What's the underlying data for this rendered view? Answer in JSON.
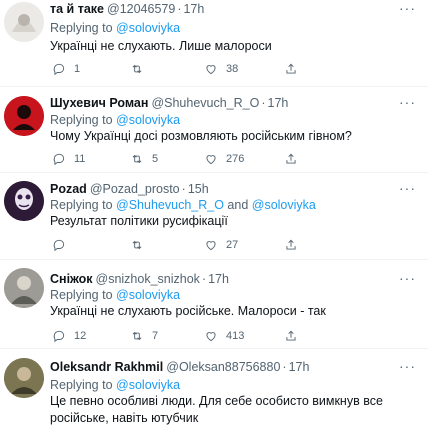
{
  "replying_label": "Replying to",
  "and_label": "and",
  "more_label": "···",
  "tweets": [
    {
      "name": "та й таке",
      "handle": "@12046579",
      "time": "17h",
      "mentions": [
        "@soloviyka"
      ],
      "text": "Українці не слухають. Лише малороси",
      "replies": "1",
      "retweets": "",
      "likes": "38"
    },
    {
      "name": "Шухевич Роман",
      "handle": "@Shuhevuch_R_O",
      "time": "17h",
      "mentions": [
        "@soloviyka"
      ],
      "text": "Чому Українці досі розмовляють російським гівном?",
      "replies": "11",
      "retweets": "5",
      "likes": "276"
    },
    {
      "name": "Pozad",
      "handle": "@Pozad_prosto",
      "time": "15h",
      "mentions": [
        "@Shuhevuch_R_O",
        "@soloviyka"
      ],
      "text": "Результат політики русифікації",
      "replies": "",
      "retweets": "",
      "likes": "27"
    },
    {
      "name": "Сніжок",
      "handle": "@snizhok_snizhok",
      "time": "17h",
      "mentions": [
        "@soloviyka"
      ],
      "text": "Українці не слухають російське. Малороси - так",
      "replies": "12",
      "retweets": "7",
      "likes": "413"
    },
    {
      "name": "Oleksandr Rakhmil",
      "handle": "@Oleksan88756880",
      "time": "17h",
      "mentions": [
        "@soloviyka"
      ],
      "text": "Це певно особливі люди. Для себе особисто вимкнув все російське, навіть ютубчик",
      "replies": "",
      "retweets": "",
      "likes": ""
    }
  ]
}
